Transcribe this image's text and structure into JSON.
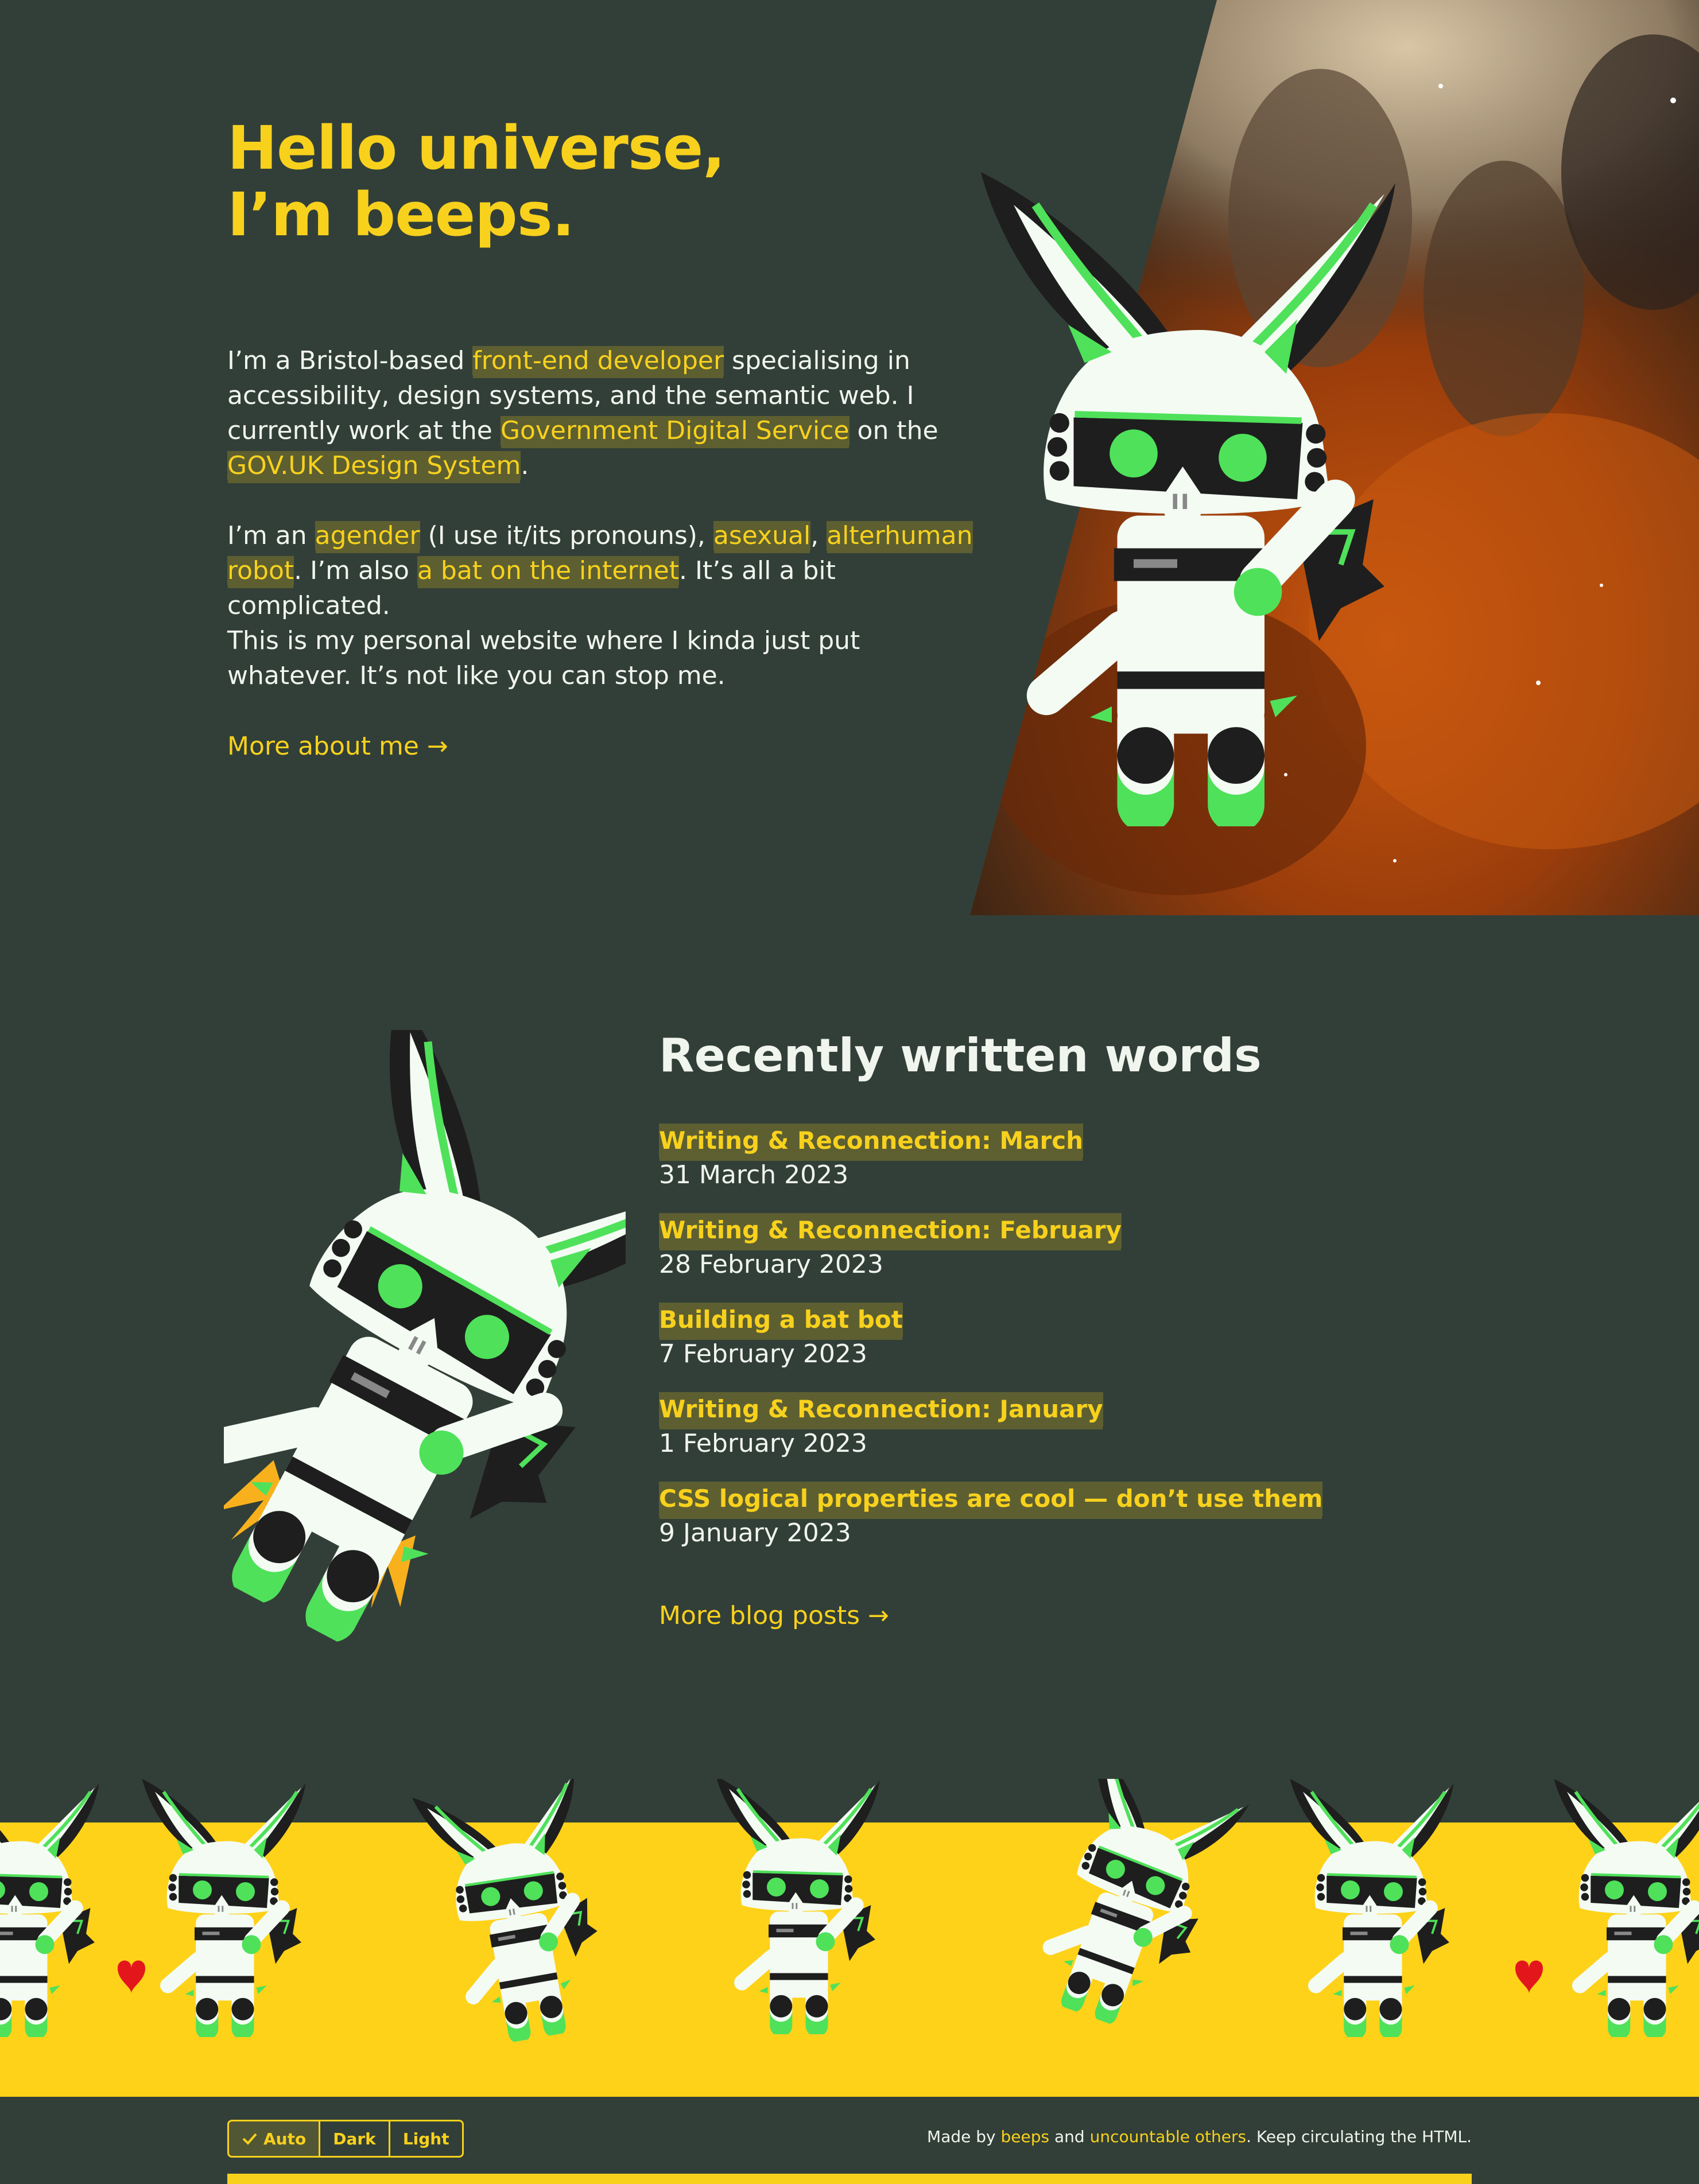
{
  "hero": {
    "title_line1": "Hello universe,",
    "title_line2": "I’m beeps.",
    "p1": {
      "t1": "I’m a Bristol-based ",
      "link1": "front-end developer",
      "t2": " specialising in accessibility, design systems, and the semantic web. I currently work at the ",
      "link2": "Government Digital Service",
      "t3": " on the ",
      "link3": "GOV.UK Design System",
      "t4": "."
    },
    "p2": {
      "t1": "I’m an ",
      "link1": "agender",
      "t2": " (I use it/its pronouns), ",
      "link2": "asexual",
      "t3": ", ",
      "link3": "alterhuman robot",
      "t4": ". I’m also ",
      "link4": "a bat on the internet",
      "t5": ". It’s all a bit complicated."
    },
    "p3": "This is my personal website where I kinda just put whatever. It’s not like you can stop me.",
    "more_link": "More about me →"
  },
  "recent": {
    "title": "Recently written words",
    "posts": [
      {
        "title": "Writing & Reconnection: March",
        "date": "31 March 2023"
      },
      {
        "title": "Writing & Reconnection: February",
        "date": "28 February 2023"
      },
      {
        "title": "Building a bat bot",
        "date": "7 February 2023"
      },
      {
        "title": "Writing & Reconnection: January",
        "date": "1 February 2023"
      },
      {
        "title": "CSS logical properties are cool — don’t use them",
        "date": "9 January 2023"
      }
    ],
    "more_link": "More blog posts →"
  },
  "footer": {
    "theme_options": [
      {
        "label": "Auto",
        "selected": true
      },
      {
        "label": "Dark",
        "selected": false
      },
      {
        "label": "Light",
        "selected": false
      }
    ],
    "credits": {
      "t1": "Made by ",
      "link1": "beeps",
      "t2": " and ",
      "link2": "uncountable others",
      "t3": ". Keep circulating the HTML."
    }
  },
  "icons": {
    "check": "check-icon",
    "mascot": "robot-bat-mascot"
  },
  "colors": {
    "background": "#323f38",
    "accent": "#f8d11d",
    "text": "#f0f5ee",
    "mascot_green": "#4fe15a",
    "mascot_black": "#1e1e1e",
    "mascot_white": "#f3fbf3",
    "band": "#fed219"
  }
}
